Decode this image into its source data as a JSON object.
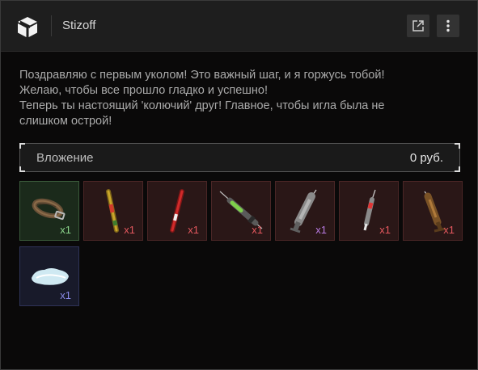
{
  "header": {
    "sender": "Stizoff",
    "logo_icon": "package-box-icon",
    "open_icon": "external-link-icon",
    "more_icon": "more-vertical-icon"
  },
  "message": {
    "lines": [
      "Поздравляю с первым уколом! Это важный шаг, и я горжусь тобой!",
      "Желаю, чтобы все прошло гладко и успешно!",
      "Теперь ты настоящий 'колючий' друг! Главное, чтобы игла была не",
      "слишком острой!"
    ]
  },
  "attachment": {
    "label": "Вложение",
    "value": "0 руб."
  },
  "items": [
    {
      "icon": "leather-belt-icon",
      "qty": "x1",
      "rarity": "green"
    },
    {
      "icon": "yellow-stick-injector-icon",
      "qty": "x1",
      "rarity": "red"
    },
    {
      "icon": "red-stick-injector-icon",
      "qty": "x1",
      "rarity": "red"
    },
    {
      "icon": "green-syringe-icon",
      "qty": "x1",
      "rarity": "red"
    },
    {
      "icon": "grey-syringe-icon",
      "qty": "x1",
      "rarity": "purple"
    },
    {
      "icon": "red-syringe-icon",
      "qty": "x1",
      "rarity": "red"
    },
    {
      "icon": "brown-syringe-icon",
      "qty": "x1",
      "rarity": "red"
    },
    {
      "icon": "cotton-pad-icon",
      "qty": "x1",
      "rarity": "blue"
    }
  ],
  "colors": {
    "green": "#8ad48a",
    "red": "#e4585e",
    "purple": "#b77ae0",
    "blue": "#8a8ae6"
  }
}
